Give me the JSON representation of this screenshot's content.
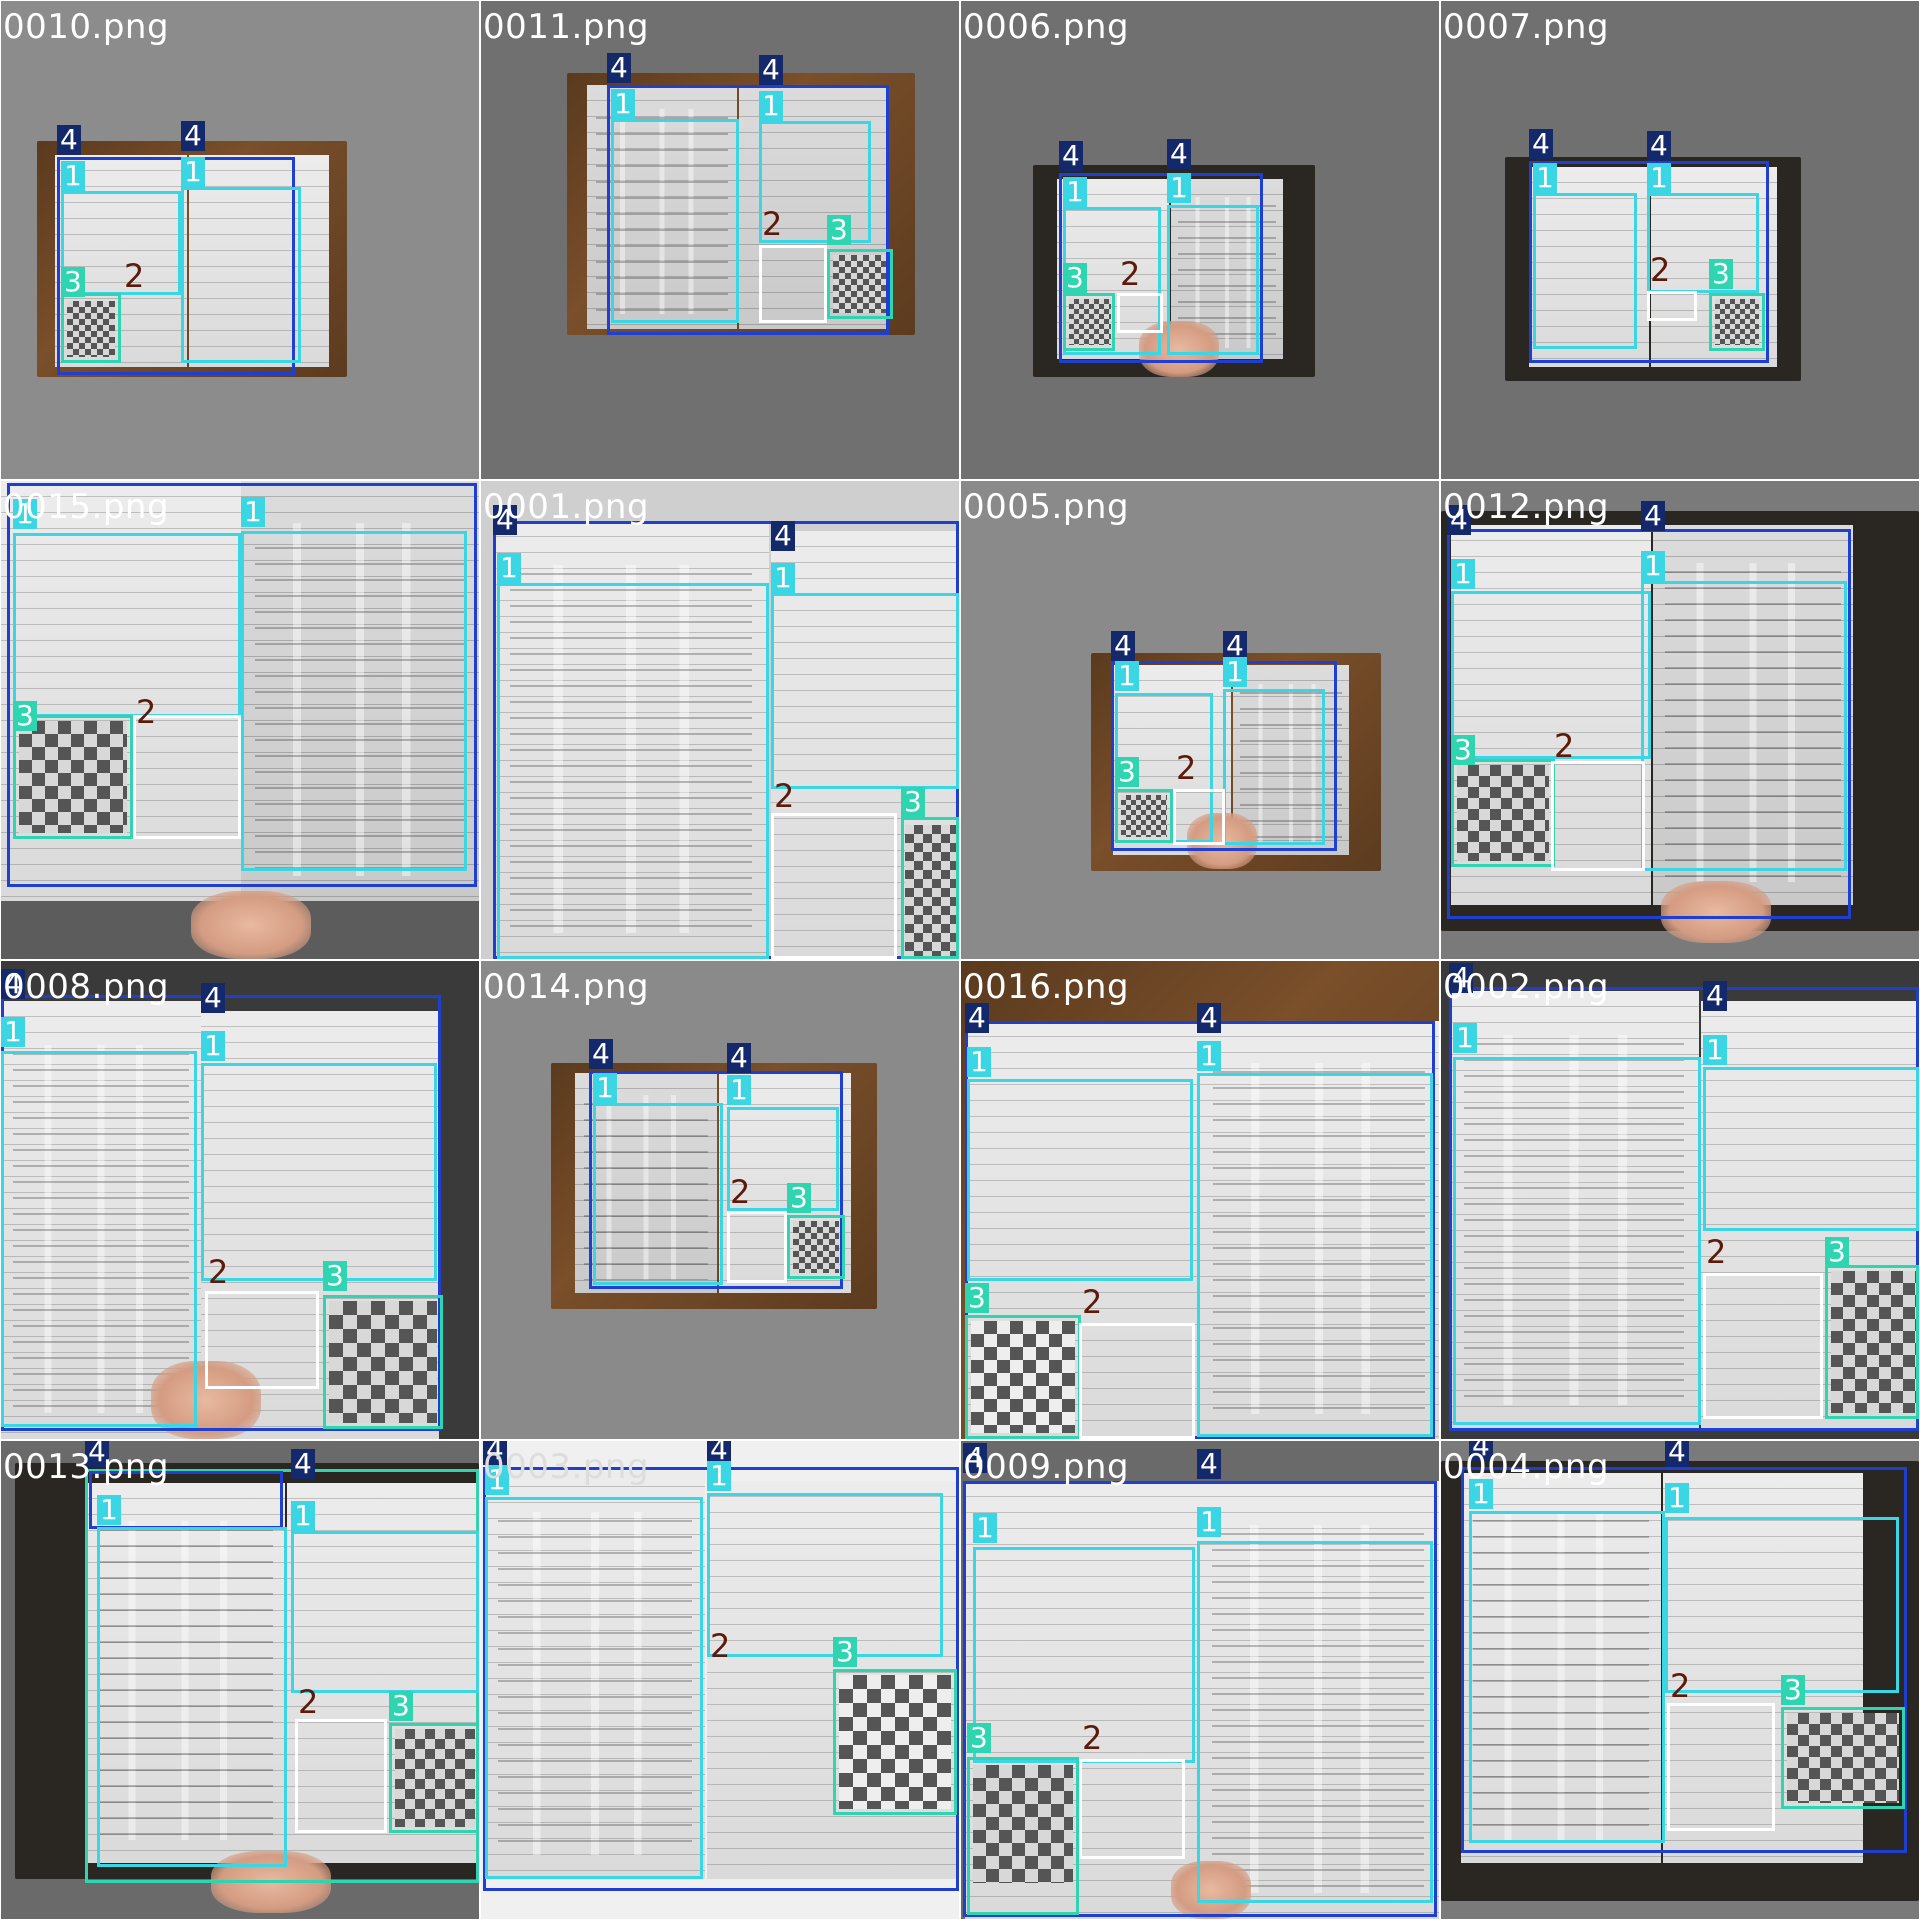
{
  "tiles": [
    {
      "name": "0010.png"
    },
    {
      "name": "0011.png"
    },
    {
      "name": "0006.png"
    },
    {
      "name": "0007.png"
    },
    {
      "name": "0015.png"
    },
    {
      "name": "0001.png"
    },
    {
      "name": "0005.png"
    },
    {
      "name": "0012.png"
    },
    {
      "name": "0008.png"
    },
    {
      "name": "0014.png"
    },
    {
      "name": "0016.png"
    },
    {
      "name": "0002.png"
    },
    {
      "name": "0013.png"
    },
    {
      "name": "0003.png"
    },
    {
      "name": "0009.png"
    },
    {
      "name": "0004.png"
    }
  ],
  "class_labels": {
    "c1": "1",
    "c2": "2",
    "c3": "3",
    "c4": "4"
  },
  "colors": {
    "class_1": "#3ad6e3",
    "class_2": "#ffffff",
    "class_3": "#2fd4b0",
    "class_4": "#1f3fd1",
    "tile_bg_light": "#8a8a8a",
    "tile_bg_dark": "#6e6e6e"
  }
}
